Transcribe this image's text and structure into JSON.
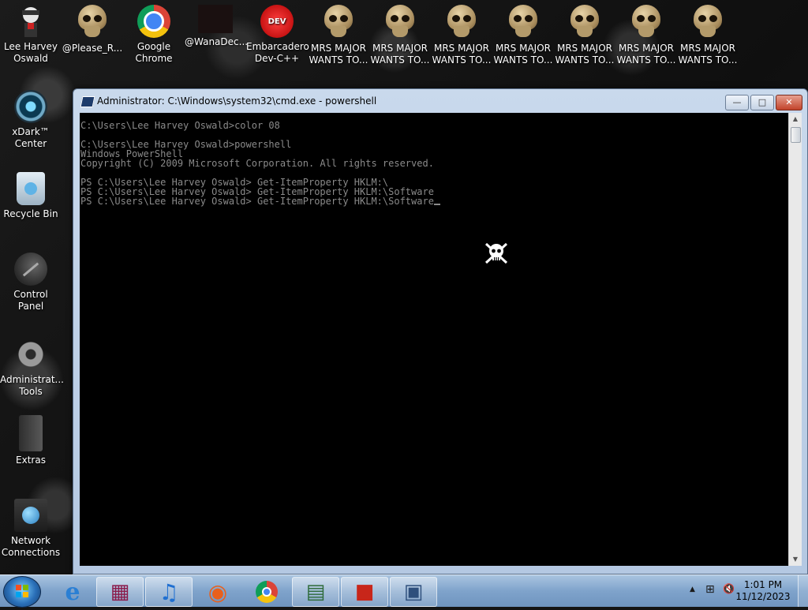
{
  "desktop": {
    "left_icons": [
      {
        "name": "lee-harvey-oswald-icon",
        "label": "Lee Harvey\nOswald"
      },
      {
        "name": "xdark-center-icon",
        "label": "xDark™\nCenter"
      },
      {
        "name": "recycle-bin-icon",
        "label": "Recycle Bin"
      },
      {
        "name": "control-panel-icon",
        "label": "Control Panel"
      },
      {
        "name": "administrative-tools-icon",
        "label": "Administrat...\nTools"
      },
      {
        "name": "extras-folder-icon",
        "label": "Extras"
      },
      {
        "name": "network-connections-icon",
        "label": "Network\nConnections"
      }
    ],
    "top_icons": [
      {
        "name": "skull-icon",
        "label": "@Please_R..."
      },
      {
        "name": "google-chrome-icon",
        "label": "Google\nChrome"
      },
      {
        "name": "dark-icon",
        "label": "@WanaDec..."
      },
      {
        "name": "embarcadero-devcpp-icon",
        "label": "Embarcadero\nDev-C++"
      },
      {
        "name": "skull-icon",
        "label": "MRS MAJOR\nWANTS TO..."
      },
      {
        "name": "skull-icon",
        "label": "MRS MAJOR\nWANTS TO..."
      },
      {
        "name": "skull-icon",
        "label": "MRS MAJOR\nWANTS TO..."
      },
      {
        "name": "skull-icon",
        "label": "MRS MAJOR\nWANTS TO..."
      },
      {
        "name": "skull-icon",
        "label": "MRS MAJOR\nWANTS TO..."
      },
      {
        "name": "skull-icon",
        "label": "MRS MAJOR\nWANTS TO..."
      },
      {
        "name": "skull-icon",
        "label": "MRS MAJOR\nWANTS TO..."
      }
    ]
  },
  "window": {
    "title": "Administrator: C:\\Windows\\system32\\cmd.exe - powershell",
    "min_label": "—",
    "max_label": "□",
    "close_label": "✕"
  },
  "console": {
    "lines": [
      "C:\\Users\\Lee Harvey Oswald>color 08",
      "",
      "C:\\Users\\Lee Harvey Oswald>powershell",
      "Windows PowerShell",
      "Copyright (C) 2009 Microsoft Corporation. All rights reserved.",
      "",
      "PS C:\\Users\\Lee Harvey Oswald> Get-ItemProperty HKLM:\\",
      "PS C:\\Users\\Lee Harvey Oswald> Get-ItemProperty HKLM:\\Software",
      "PS C:\\Users\\Lee Harvey Oswald> Get-ItemProperty HKLM:\\Software"
    ]
  },
  "taskbar": {
    "items": [
      {
        "name": "internet-explorer-icon",
        "glyph": "e",
        "pinned_active": false
      },
      {
        "name": "winrar-icon",
        "glyph": "▦",
        "pinned_active": true
      },
      {
        "name": "itunes-icon",
        "glyph": "♫",
        "pinned_active": true
      },
      {
        "name": "firefox-icon",
        "glyph": "◉",
        "pinned_active": false
      },
      {
        "name": "chrome-icon",
        "glyph": "◎",
        "pinned_active": false
      },
      {
        "name": "system-monitor-icon",
        "glyph": "▤",
        "pinned_active": true
      },
      {
        "name": "toolbox-icon",
        "glyph": "■",
        "pinned_active": true
      },
      {
        "name": "cmd-window-icon",
        "glyph": "▣",
        "pinned_active": true
      }
    ],
    "clock_time": "1:01 PM",
    "clock_date": "11/12/2023",
    "tray_arrow": "▲",
    "tray_network": "⊞",
    "tray_volume": "🔇"
  },
  "colors": {
    "console_text": "#8a8a8a",
    "console_bg": "#000000",
    "accent": "#4f7fbf"
  }
}
